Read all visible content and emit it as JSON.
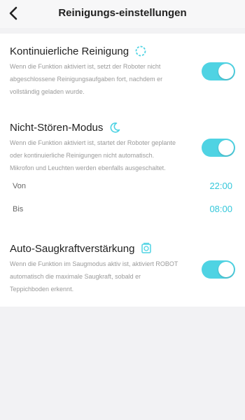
{
  "header": {
    "title": "Reinigungs-einstellungen",
    "back_icon": "chevron-left-icon"
  },
  "colors": {
    "accent": "#4fd3e3",
    "time_text": "#34c7da",
    "background": "#f2f2f4",
    "panel": "#ffffff"
  },
  "sections": [
    {
      "title": "Kontinuierliche Reinigung",
      "icon": "continuous-cleaning-icon",
      "description_lines": [
        "Wenn die Funktion aktiviert ist, setzt der Roboter nicht",
        "abgeschlossene Reinigungsaufgaben fort, nachdem er",
        "vollständig geladen wurde."
      ],
      "enabled": true
    },
    {
      "title": "Nicht-Stören-Modus",
      "icon": "moon-icon",
      "description_lines": [
        "Wenn die Funktion aktiviert ist, startet der Roboter geplante",
        "oder kontinuierliche Reinigungen nicht automatisch.",
        "Mikrofon und Leuchten werden ebenfalls ausgeschaltet."
      ],
      "enabled": true,
      "from_label": "Von",
      "from_value": "22:00",
      "to_label": "Bis",
      "to_value": "08:00"
    },
    {
      "title": "Auto-Saugkraftverstärkung",
      "icon": "suction-boost-icon",
      "description_lines": [
        "Wenn die Funktion im Saugmodus aktiv ist, aktiviert ROBOT",
        "automatisch die maximale Saugkraft, sobald er",
        "Teppichboden erkennt."
      ],
      "enabled": true
    }
  ]
}
